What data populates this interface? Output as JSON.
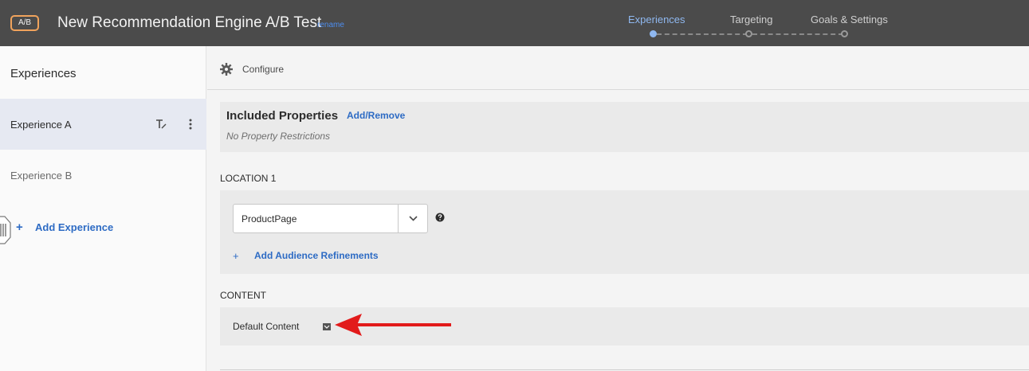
{
  "header": {
    "badge": "A/B",
    "title": "New Recommendation Engine A/B Test",
    "rename_label": "rename",
    "steps": [
      {
        "label": "Experiences",
        "active": true
      },
      {
        "label": "Targeting",
        "active": false
      },
      {
        "label": "Goals & Settings",
        "active": false
      }
    ]
  },
  "sidebar": {
    "title": "Experiences",
    "experiences": [
      {
        "label": "Experience A",
        "selected": true
      },
      {
        "label": "Experience B",
        "selected": false
      }
    ],
    "add_label": "Add Experience",
    "add_icon": "+"
  },
  "main": {
    "configure_label": "Configure",
    "properties": {
      "title": "Included Properties",
      "link": "Add/Remove",
      "note": "No Property Restrictions"
    },
    "location": {
      "label": "LOCATION 1",
      "selected": "ProductPage",
      "add_icon": "+",
      "add_audience_label": "Add Audience Refinements"
    },
    "content": {
      "label": "CONTENT",
      "value": "Default Content"
    }
  },
  "colors": {
    "header_bg": "#4b4b4b",
    "accent_blue": "#2d6bc4",
    "badge_border": "#f0a35c",
    "annotation_arrow": "#e21b1b"
  }
}
